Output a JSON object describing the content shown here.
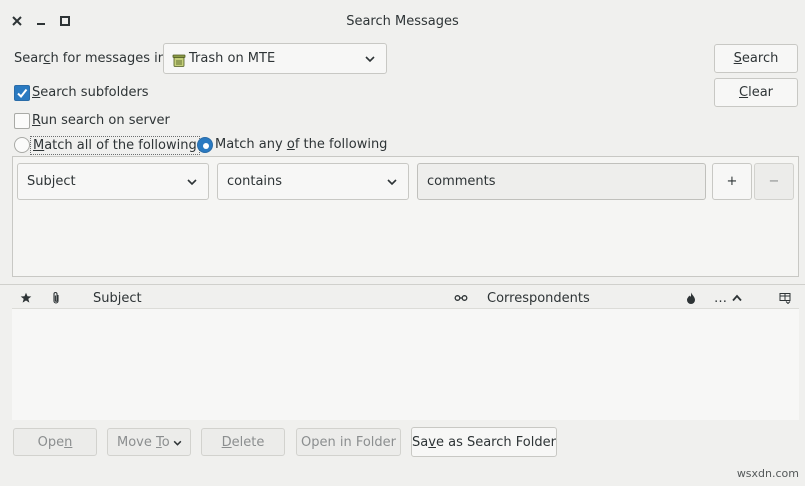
{
  "window": {
    "title": "Search Messages"
  },
  "search_in": {
    "label_pre": "Sear",
    "label_u": "c",
    "label_post": "h for messages in:",
    "folder": "Trash on MTE"
  },
  "options": {
    "subfolders_pre": "",
    "subfolders_u": "S",
    "subfolders_post": "earch subfolders",
    "server_pre": "",
    "server_u": "R",
    "server_post": "un search on server",
    "match_all_pre": "",
    "match_all_u": "M",
    "match_all_post": "atch all of the following",
    "match_any_pre": "Match any ",
    "match_any_u": "o",
    "match_any_post": "f the following"
  },
  "side_buttons": {
    "search_u": "S",
    "search_post": "earch",
    "clear_u": "C",
    "clear_post": "lear"
  },
  "rule": {
    "field": "Subject",
    "operator": "contains",
    "value": "comments",
    "add_label": "+",
    "remove_label": "−"
  },
  "columns": {
    "subject": "Subject",
    "correspondents": "Correspondents",
    "more": "…"
  },
  "bottom_buttons": {
    "open_pre": "Ope",
    "open_u": "n",
    "move_pre": "Move ",
    "move_u": "T",
    "move_post": "o",
    "delete_u": "D",
    "delete_post": "elete",
    "open_folder": "Open in Folder",
    "save_pre": "Sa",
    "save_u": "v",
    "save_post": "e as Search Folder"
  },
  "colors": {
    "accent": "#2a7ac1",
    "background": "#f0f0ee"
  },
  "watermark": "wsxdn.com"
}
